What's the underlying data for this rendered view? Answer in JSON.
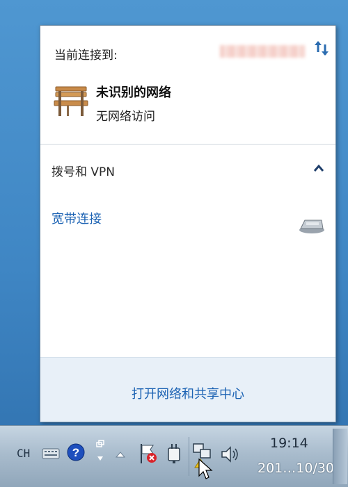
{
  "popup": {
    "current_connection_label": "当前连接到:",
    "network": {
      "name": "未识别的网络",
      "status": "无网络访问"
    },
    "dialup_section": {
      "title": "拨号和 VPN",
      "items": [
        {
          "label": "宽带连接",
          "icon": "broadband-modem-icon"
        }
      ]
    },
    "footer_link": "打开网络和共享中心"
  },
  "taskbar": {
    "language": "CH",
    "clock_time": "19:14",
    "clock_date": "201…10/30",
    "icons": [
      "keyboard-icon",
      "help-icon",
      "expand-icon",
      "show-hidden-icons-arrow",
      "action-center-flag-icon",
      "power-plug-icon",
      "network-icon",
      "volume-icon"
    ]
  },
  "colors": {
    "link": "#1b62b3",
    "footer_bg": "#e8f0f8",
    "desktop": "#3f86c4"
  }
}
